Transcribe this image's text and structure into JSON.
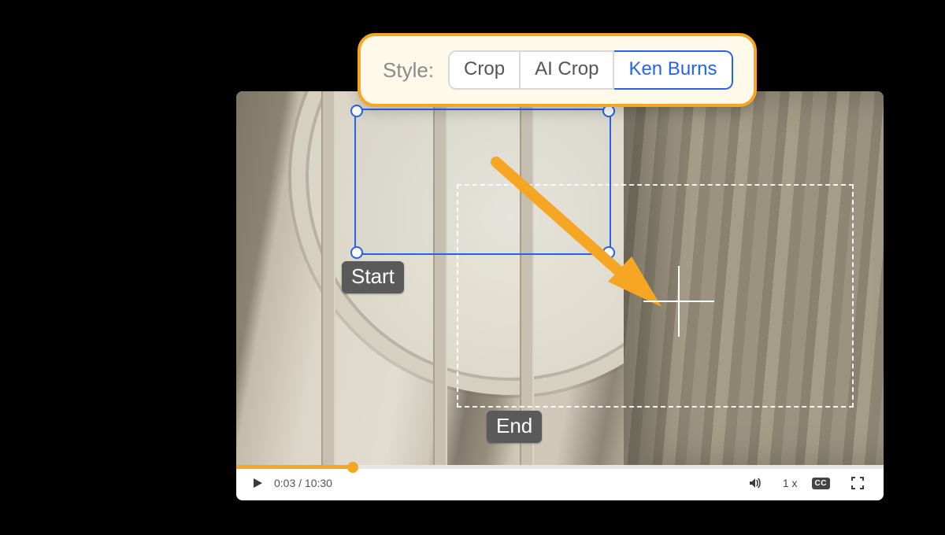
{
  "style_picker": {
    "label": "Style:",
    "options": [
      "Crop",
      "AI Crop",
      "Ken Burns"
    ],
    "active_index": 2
  },
  "crop": {
    "start_label": "Start",
    "end_label": "End"
  },
  "player": {
    "current_time": "0:03",
    "duration": "10:30",
    "time_display": "0:03 / 10:30",
    "progress_pct": 18,
    "speed_label": "1 x",
    "cc_label": "CC"
  },
  "colors": {
    "accent_orange": "#F5A623",
    "accent_blue": "#2563eb"
  }
}
